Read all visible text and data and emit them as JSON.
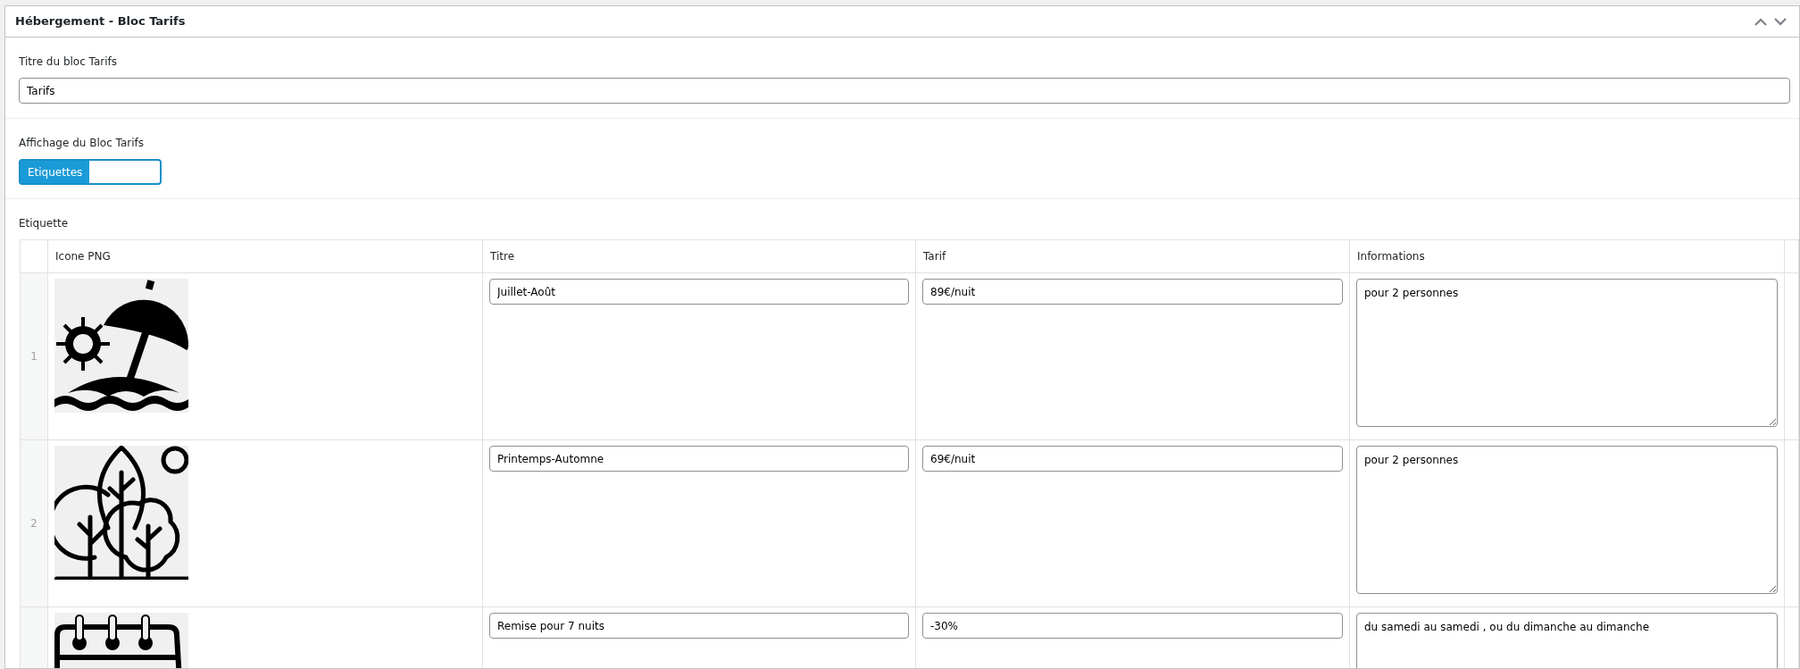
{
  "panel": {
    "title": "Hébergement - Bloc Tarifs"
  },
  "title_field": {
    "label": "Titre du bloc Tarifs",
    "value": "Tarifs"
  },
  "display_field": {
    "label": "Affichage du Bloc Tarifs",
    "toggle": {
      "label": "Etiquettes",
      "on": true
    }
  },
  "repeater": {
    "label": "Etiquette",
    "columns": [
      "Icone PNG",
      "Titre",
      "Tarif",
      "Informations"
    ],
    "rows": [
      {
        "number": "1",
        "titre": "Juillet-Août",
        "tarif": "89€/nuit",
        "informations": "pour 2 personnes"
      },
      {
        "number": "2",
        "titre": "Printemps-Automne",
        "tarif": "69€/nuit",
        "informations": "pour 2 personnes"
      },
      {
        "titre": "Remise pour 7 nuits",
        "tarif": "-30%",
        "informations": "du samedi au samedi , ou du dimanche au dimanche"
      }
    ]
  }
}
